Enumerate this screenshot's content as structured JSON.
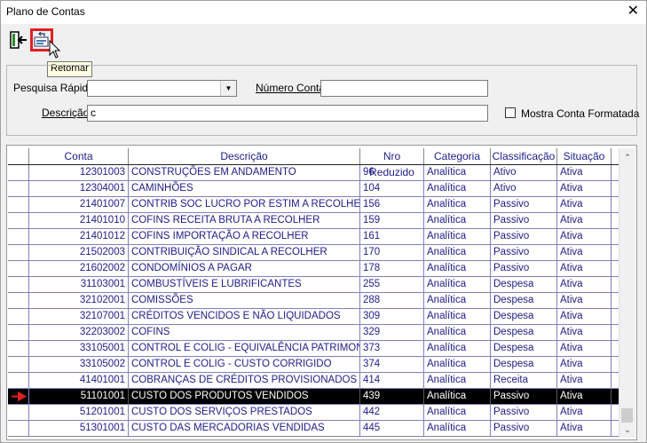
{
  "window": {
    "title": "Plano de Contas",
    "close_glyph": "✕"
  },
  "toolbar": {
    "exit_icon": "exit-door-icon",
    "return_icon": "return-icon",
    "tooltip": "Retornar"
  },
  "filters": {
    "quick_search_label": "Pesquisa Rápida",
    "quick_search_value": "",
    "account_number_label": "Número Conta",
    "account_number_value": "",
    "description_label": "Descrição",
    "description_value": "c",
    "show_formatted_label": "Mostra Conta Formatada",
    "show_formatted_checked": false
  },
  "grid": {
    "columns": [
      "Conta",
      "Descrição",
      "Nro Reduzido",
      "Categoria",
      "Classificação",
      "Situação"
    ],
    "rows": [
      [
        "12301003",
        "CONSTRUÇÕES EM ANDAMENTO",
        "96",
        "Analítica",
        "Ativo",
        "Ativa"
      ],
      [
        "12304001",
        "CAMINHÕES",
        "104",
        "Analítica",
        "Ativo",
        "Ativa"
      ],
      [
        "21401007",
        "CONTRIB SOC LUCRO POR ESTIM A RECOLHER",
        "156",
        "Analítica",
        "Passivo",
        "Ativa"
      ],
      [
        "21401010",
        "COFINS RECEITA BRUTA A RECOLHER",
        "159",
        "Analítica",
        "Passivo",
        "Ativa"
      ],
      [
        "21401012",
        "COFINS IMPORTAÇÃO A RECOLHER",
        "161",
        "Analítica",
        "Passivo",
        "Ativa"
      ],
      [
        "21502003",
        "CONTRIBUIÇÃO SINDICAL A RECOLHER",
        "170",
        "Analítica",
        "Passivo",
        "Ativa"
      ],
      [
        "21602002",
        "CONDOMÍNIOS A PAGAR",
        "178",
        "Analítica",
        "Passivo",
        "Ativa"
      ],
      [
        "31103001",
        "COMBUSTÍVEIS E LUBRIFICANTES",
        "255",
        "Analítica",
        "Despesa",
        "Ativa"
      ],
      [
        "32102001",
        "COMISSÕES",
        "288",
        "Analítica",
        "Despesa",
        "Ativa"
      ],
      [
        "32107001",
        "CRÉDITOS VENCIDOS E NÃO LIQUIDADOS",
        "309",
        "Analítica",
        "Despesa",
        "Ativa"
      ],
      [
        "32203002",
        "COFINS",
        "329",
        "Analítica",
        "Despesa",
        "Ativa"
      ],
      [
        "33105001",
        "CONTROL E COLIG - EQUIVALÊNCIA PATRIMON",
        "373",
        "Analítica",
        "Despesa",
        "Ativa"
      ],
      [
        "33105002",
        "CONTROL E COLIG - CUSTO CORRIGIDO",
        "374",
        "Analítica",
        "Despesa",
        "Ativa"
      ],
      [
        "41401001",
        "COBRANÇAS DE CRÉDITOS PROVISIONADOS",
        "414",
        "Analítica",
        "Receita",
        "Ativa"
      ],
      [
        "51101001",
        "CUSTO DOS PRODUTOS VENDIDOS",
        "439",
        "Analítica",
        "Passivo",
        "Ativa"
      ],
      [
        "51201001",
        "CUSTO DOS SERVIÇOS PRESTADOS",
        "442",
        "Analítica",
        "Passivo",
        "Ativa"
      ],
      [
        "51301001",
        "CUSTO DAS MERCADORIAS VENDIDAS",
        "445",
        "Analítica",
        "Passivo",
        "Ativa"
      ]
    ],
    "selected_index": 14,
    "selected_arrow_color": "#e02020"
  },
  "colors": {
    "grid_text": "#1c1c8a",
    "selected_bg": "#000000",
    "highlight_border": "#e02020"
  }
}
